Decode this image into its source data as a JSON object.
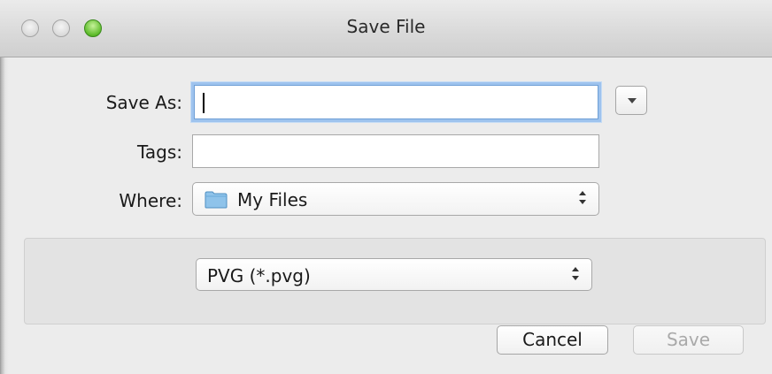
{
  "window": {
    "title": "Save File"
  },
  "form": {
    "save_as_label": "Save As:",
    "save_as_value": "",
    "tags_label": "Tags:",
    "tags_value": "",
    "where_label": "Where:",
    "where_value": "My Files",
    "where_icon": "folder-icon"
  },
  "format": {
    "selected": "PVG (*.pvg)"
  },
  "buttons": {
    "cancel_label": "Cancel",
    "save_label": "Save",
    "save_enabled": false
  },
  "colors": {
    "focus_ring": "#9ec3ee",
    "zoom_button": "#5dbb2a",
    "folder": "#8fc3ea"
  }
}
